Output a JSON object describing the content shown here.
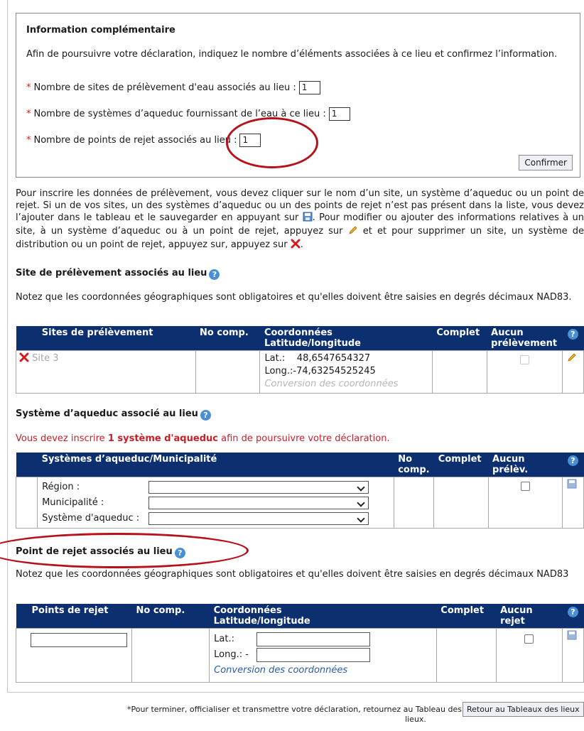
{
  "info": {
    "title": "Information complémentaire",
    "description": "Afin de poursuivre votre déclaration, indiquez le nombre d’éléments associées à ce lieu et confirmez l’information.",
    "required_mark": "*",
    "fields": [
      {
        "label": "Nombre de sites de prélèvement d'eau associés au lieu :",
        "value": "1"
      },
      {
        "label": "Nombre de systèmes d’aqueduc fournissant de l’eau à ce lieu :",
        "value": "1"
      },
      {
        "label": "Nombre de points de rejet associés au lieu :",
        "value": "1"
      }
    ],
    "confirm_label": "Confirmer"
  },
  "instructions": {
    "part1": "Pour inscrire les données de prélèvement, vous devez cliquer sur le nom d’un site, un système d’aqueduc ou un point de rejet. Si un de vos sites, un des systèmes d’aqueduc ou un des points de rejet n’est pas présent dans la liste, vous devez l’ajouter dans le tableau et le sauvegarder en appuyant sur",
    "part2": ". Pour modifier ou ajouter des informations relatives à un site, à un système d’aqueduc ou à un point de rejet, appuyez sur",
    "part3": "et et pour supprimer un site, un système de distribution ou un point de rejet, appuyez sur, appuyez sur",
    "part4": "."
  },
  "site_section": {
    "title": "Site de prélèvement associés au lieu",
    "note": "Notez que les coordonnées géographiques sont obligatoires et qu'elles doivent être saisies en degrés décimaux NAD83.",
    "headers": {
      "name": "Sites de prélèvement",
      "comp": "No comp.",
      "coords1": "Coordonnées",
      "coords2": "Latitude/longitude",
      "complete": "Complet",
      "none1": "Aucun",
      "none2": "prélèvement",
      "help": "?"
    },
    "row": {
      "name": "Site 3",
      "lat_label": "Lat.:",
      "lat": "48,6547654327",
      "long_label": "Long.:",
      "long": "-74,63254525245",
      "conversion": "Conversion des coordonnées"
    }
  },
  "aqueduct_section": {
    "title": "Système d’aqueduc associé au lieu",
    "warning_pre": "Vous devez inscrire",
    "warning_bold": "1 système d'aqueduc",
    "warning_post": "afin de poursuivre votre déclaration.",
    "headers": {
      "name": "Systèmes d’aqueduc/Municipalité",
      "comp1": "No",
      "comp2": "comp.",
      "complete": "Complet",
      "none1": "Aucun",
      "none2": "prélèv.",
      "help": "?"
    },
    "labels": {
      "region": "Région :",
      "municipality": "Municipalité :",
      "system": "Système d'aqueduc :"
    },
    "selects": {
      "region": "",
      "municipality": "",
      "system": ""
    }
  },
  "discharge_section": {
    "title": "Point de rejet associés au lieu",
    "note": "Notez que les coordonnées géographiques sont obligatoires et qu'elles doivent être saisies en degrés décimaux NAD83",
    "headers": {
      "name": "Points de rejet",
      "comp": "No comp.",
      "coords1": "Coordonnées",
      "coords2": "Latitude/longitude",
      "complete": "Complet",
      "none1": "Aucun",
      "none2": "rejet",
      "help": "?"
    },
    "row": {
      "name_value": "",
      "lat_label": "Lat.:",
      "lat_value": "",
      "long_label": "Long.: -",
      "long_value": "",
      "conversion": "Conversion des coordonnées"
    }
  },
  "footer": {
    "text1": "*Pour terminer, officialiser et transmettre votre déclaration, retournez au Tableau des",
    "text2": "lieux.",
    "button": "Retour au Tableaux des lieux"
  },
  "colors": {
    "header_bg": "#0b2f6f",
    "required": "#cc2222",
    "warning": "#c8202a",
    "annotation": "#b5121b",
    "link": "#2b5ca8"
  }
}
